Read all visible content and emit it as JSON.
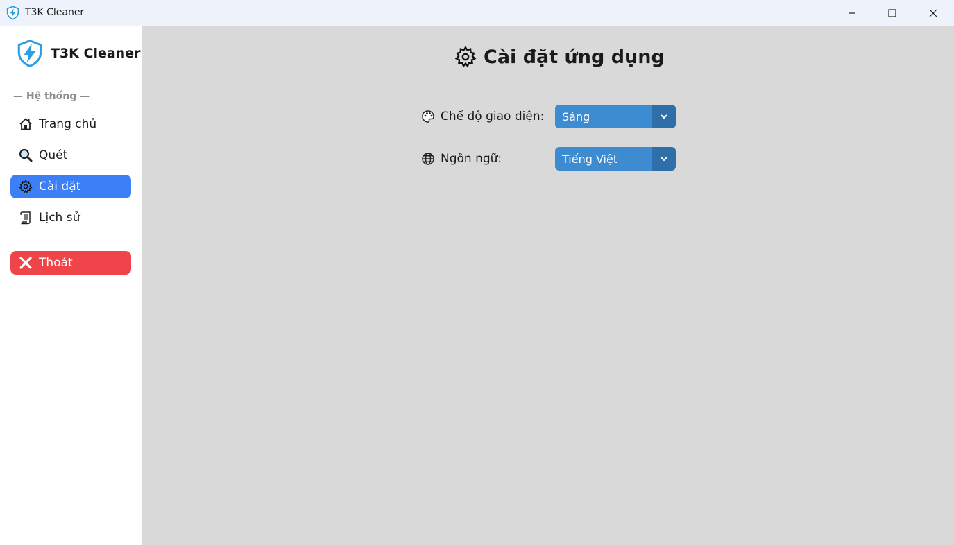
{
  "window": {
    "title": "T3K Cleaner"
  },
  "sidebar": {
    "brand": "T3K Cleaner",
    "section_label": "— Hệ thống —",
    "items": [
      {
        "label": "Trang chủ",
        "icon": "home-icon"
      },
      {
        "label": "Quét",
        "icon": "magnifier-icon"
      },
      {
        "label": "Cài đặt",
        "icon": "gear-icon",
        "active": true
      },
      {
        "label": "Lịch sử",
        "icon": "scroll-icon"
      }
    ],
    "exit_label": "Thoát"
  },
  "main": {
    "title": "Cài đặt ứng dụng",
    "settings": [
      {
        "label": "Chế độ giao diện:",
        "icon": "palette-icon",
        "value": "Sáng"
      },
      {
        "label": "Ngôn ngữ:",
        "icon": "globe-icon",
        "value": "Tiếng Việt"
      }
    ]
  },
  "colors": {
    "active_nav": "#3d7ff5",
    "exit_button": "#ef4449",
    "select_bg": "#3d8bd1",
    "select_arrow_bg": "#2e6ea9",
    "main_bg": "#d9d9d9"
  }
}
